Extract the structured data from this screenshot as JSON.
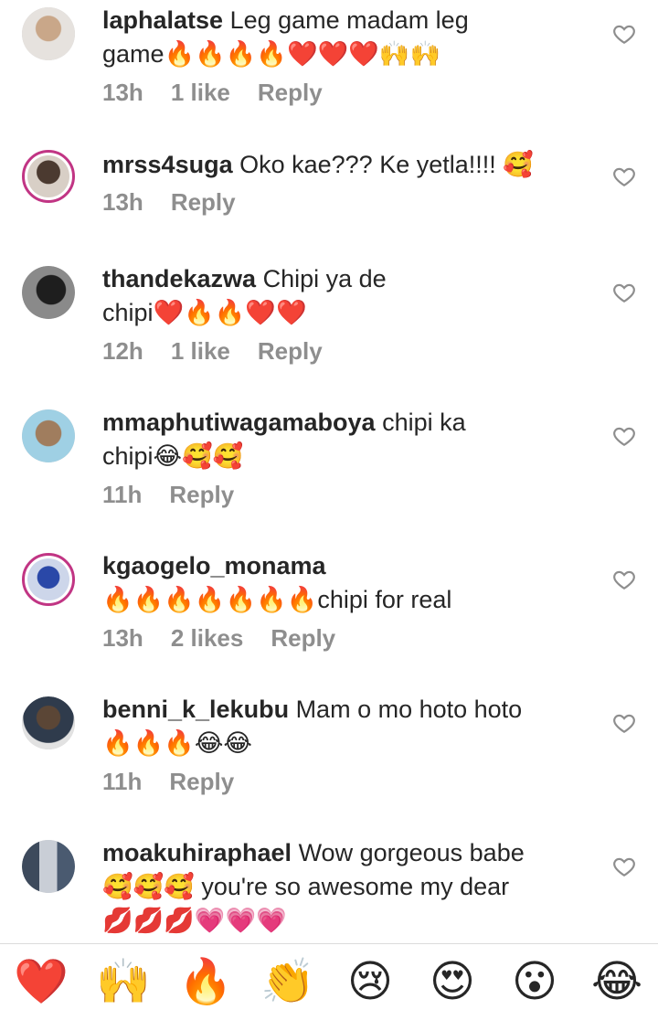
{
  "comments": [
    {
      "username": "laphalatse",
      "text": " Leg game madam leg\ngame🔥🔥🔥🔥❤️❤️❤️🙌🙌",
      "time": "13h",
      "likes": "1 like",
      "reply": "Reply",
      "avatar_color": "#d9d4cf",
      "story": false
    },
    {
      "username": "mrss4suga",
      "text": " Oko kae??? Ke yetla!!!! 🥰",
      "time": "13h",
      "likes": "",
      "reply": "Reply",
      "avatar_color": "#6b5a4e",
      "story": true
    },
    {
      "username": "thandekazwa",
      "text": " Chipi ya de\nchipi❤️🔥🔥❤️❤️",
      "time": "12h",
      "likes": "1 like",
      "reply": "Reply",
      "avatar_color": "#3a3a3a",
      "story": false
    },
    {
      "username": "mmaphutiwagamaboya",
      "text": " chipi ka\nchipi😂🥰🥰",
      "time": "11h",
      "likes": "",
      "reply": "Reply",
      "avatar_color": "#8ec0d8",
      "story": false
    },
    {
      "username": "kgaogelo_monama",
      "text": "\n🔥🔥🔥🔥🔥🔥🔥chipi for real",
      "time": "13h",
      "likes": "2 likes",
      "reply": "Reply",
      "avatar_color": "#3559b5",
      "story": true
    },
    {
      "username": "benni_k_lekubu",
      "text": " Mam o mo hoto hoto\n🔥🔥🔥😂😂",
      "time": "11h",
      "likes": "",
      "reply": "Reply",
      "avatar_color": "#2f3b4c",
      "story": false
    },
    {
      "username": "moakuhiraphael",
      "text": " Wow gorgeous babe\n🥰🥰🥰 you're so awesome my dear\n💋💋💋💗💗💗",
      "time": "",
      "likes": "",
      "reply": "",
      "avatar_color": "#6f7f93",
      "story": false
    }
  ],
  "emoji_bar": [
    "❤️",
    "🙌",
    "🔥",
    "👏",
    "😢",
    "😍",
    "😮",
    "😂"
  ]
}
